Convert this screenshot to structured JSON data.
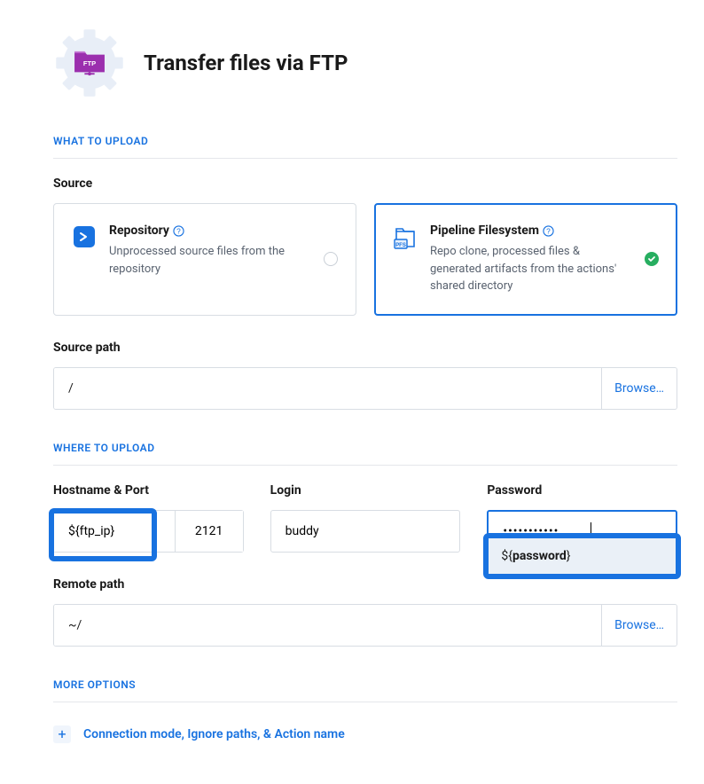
{
  "header": {
    "title": "Transfer files via FTP",
    "badge_text": "FTP"
  },
  "what_to_upload": {
    "section_label": "WHAT TO UPLOAD",
    "source_label": "Source",
    "options": {
      "repository": {
        "title": "Repository",
        "desc": "Unprocessed source files from the repository"
      },
      "pipeline_fs": {
        "title": "Pipeline Filesystem",
        "desc": "Repo clone, processed files & generated artifacts from the actions' shared directory",
        "badge": "PFS"
      }
    },
    "source_path": {
      "label": "Source path",
      "value": "/",
      "browse": "Browse…"
    }
  },
  "where_to_upload": {
    "section_label": "WHERE TO UPLOAD",
    "hostname": {
      "label": "Hostname & Port",
      "host_value": "${ftp_ip}",
      "port_value": "2121"
    },
    "login": {
      "label": "Login",
      "value": "buddy"
    },
    "password": {
      "label": "Password",
      "value": "•••••••••••",
      "suggestion": "${password}"
    },
    "remote_path": {
      "label": "Remote path",
      "value": "~/",
      "browse": "Browse…"
    }
  },
  "more_options": {
    "section_label": "MORE OPTIONS",
    "expand_label": "Connection mode, Ignore paths, & Action name"
  },
  "colors": {
    "primary": "#1872e0",
    "border": "#d8dde3",
    "text_muted": "#5a6370",
    "success": "#27ae60",
    "badge_bg": "#9b2fae"
  }
}
